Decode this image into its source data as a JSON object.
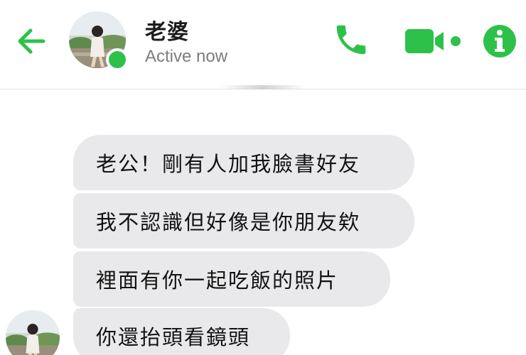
{
  "header": {
    "contact_name": "老婆",
    "status": "Active now",
    "back_icon": "arrow-left-icon",
    "actions": [
      {
        "name": "call",
        "icon": "phone-icon"
      },
      {
        "name": "video",
        "icon": "video-camera-icon"
      },
      {
        "name": "info",
        "icon": "info-icon"
      }
    ]
  },
  "colors": {
    "accent": "#2ec14a",
    "bubble_bg": "#e9e9eb",
    "status_text": "#7d7d7d"
  },
  "messages": [
    {
      "from": "contact",
      "text": "老公！剛有人加我臉書好友"
    },
    {
      "from": "contact",
      "text": "我不認識但好像是你朋友欸"
    },
    {
      "from": "contact",
      "text": "裡面有你一起吃飯的照片"
    },
    {
      "from": "contact",
      "text": "你還抬頭看鏡頭"
    }
  ]
}
